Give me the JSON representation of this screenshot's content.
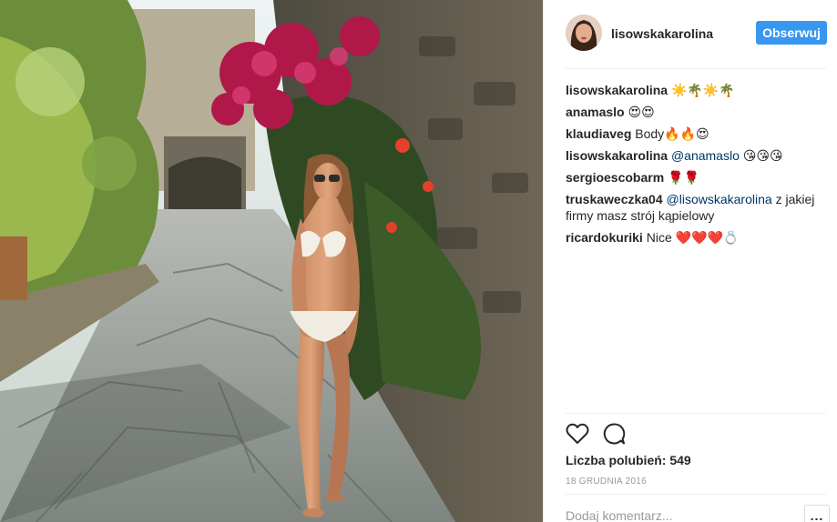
{
  "post": {
    "username": "lisowskakarolina",
    "follow_label": "Obserwuj",
    "photo_icon": "vacation-photo"
  },
  "comments": [
    {
      "user": "lisowskakarolina",
      "mention": "",
      "text": "☀️🌴☀️🌴"
    },
    {
      "user": "anamaslo",
      "mention": "",
      "text": "😍😍"
    },
    {
      "user": "klaudiaveg",
      "mention": "",
      "text": "Body🔥🔥😍"
    },
    {
      "user": "lisowskakarolina",
      "mention": "@anamaslo",
      "text": "😘😘😘"
    },
    {
      "user": "sergioescobarm",
      "mention": "",
      "text": "🌹🌹"
    },
    {
      "user": "truskaweczka04",
      "mention": "@lisowskakarolina",
      "text": "z jakiej firmy masz strój kąpielowy"
    },
    {
      "user": "ricardokuriki",
      "mention": "",
      "text": "Nice ❤️❤️❤️💍"
    }
  ],
  "stats": {
    "likes_label": "Liczba polubień: 549",
    "date": "18 GRUDNIA 2016"
  },
  "comment_box": {
    "placeholder": "Dodaj komentarz...",
    "more_label": "..."
  },
  "icons": {
    "like": "heart-icon",
    "comment": "comment-bubble-icon"
  },
  "colors": {
    "accent": "#3897f0",
    "mention": "#003569",
    "muted": "#999999"
  }
}
